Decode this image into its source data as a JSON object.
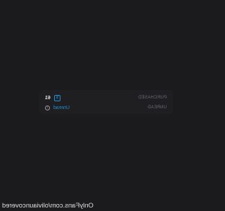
{
  "summary": {
    "purchased": {
      "label": "PURCHASED",
      "count": "61",
      "badge_icon": "purchase-tag-icon"
    },
    "unread": {
      "label": "UNREAD",
      "link_text": "Unread",
      "icon": "info-icon"
    }
  },
  "watermark": "OnlyFans.com/oliviauncovered",
  "colors": {
    "background": "#1b1b1d",
    "card": "#1f1f22",
    "accent": "#1f8fd6"
  }
}
